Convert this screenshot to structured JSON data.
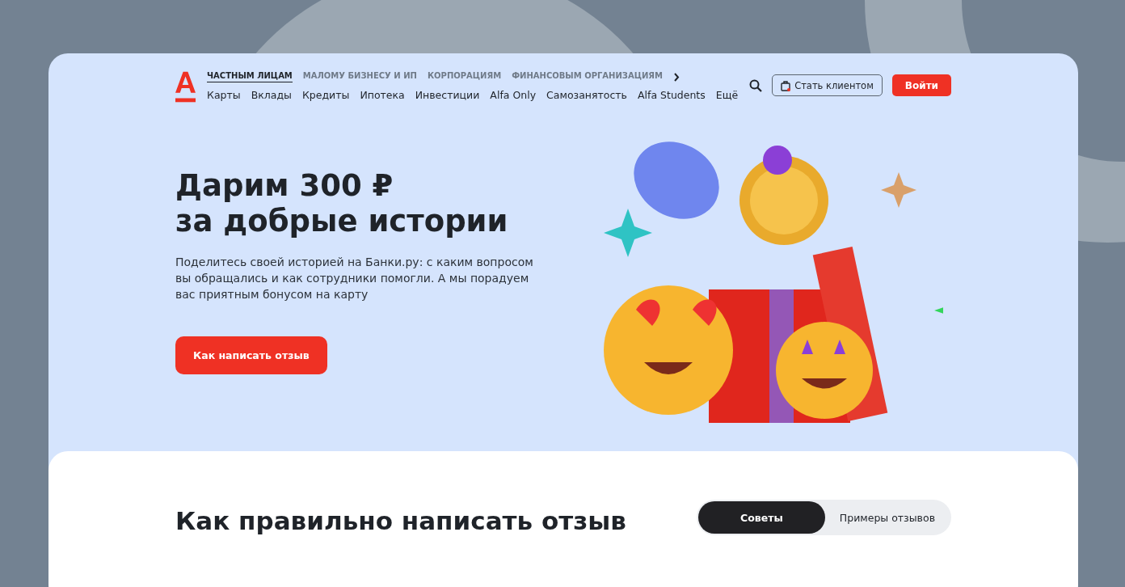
{
  "segments": [
    {
      "label": "ЧАСТНЫМ ЛИЦАМ",
      "selected": true
    },
    {
      "label": "МАЛОМУ БИЗНЕСУ И ИП",
      "selected": false
    },
    {
      "label": "КОРПОРАЦИЯМ",
      "selected": false
    },
    {
      "label": "ФИНАНСОВЫМ ОРГАНИЗАЦИЯМ",
      "selected": false
    }
  ],
  "menu": [
    "Карты",
    "Вклады",
    "Кредиты",
    "Ипотека",
    "Инвестиции",
    "Alfa Only",
    "Самозанятость",
    "Alfa Students",
    "Ещё"
  ],
  "header_buttons": {
    "become_client": "Стать клиентом",
    "login": "Войти"
  },
  "hero": {
    "title_line_1": "Дарим 300 ₽",
    "title_line_2": "за добрые истории",
    "text": "Поделитесь своей историей на Банки.ру: с каким вопросом вы обращались и как сотрудники помогли. А мы порадуем вас приятным бонусом на карту",
    "button": "Как написать отзыв"
  },
  "section": {
    "title": "Как правильно написать отзыв",
    "tabs": [
      {
        "label": "Советы",
        "selected": true
      },
      {
        "label": "Примеры отзывов",
        "selected": false
      }
    ]
  }
}
